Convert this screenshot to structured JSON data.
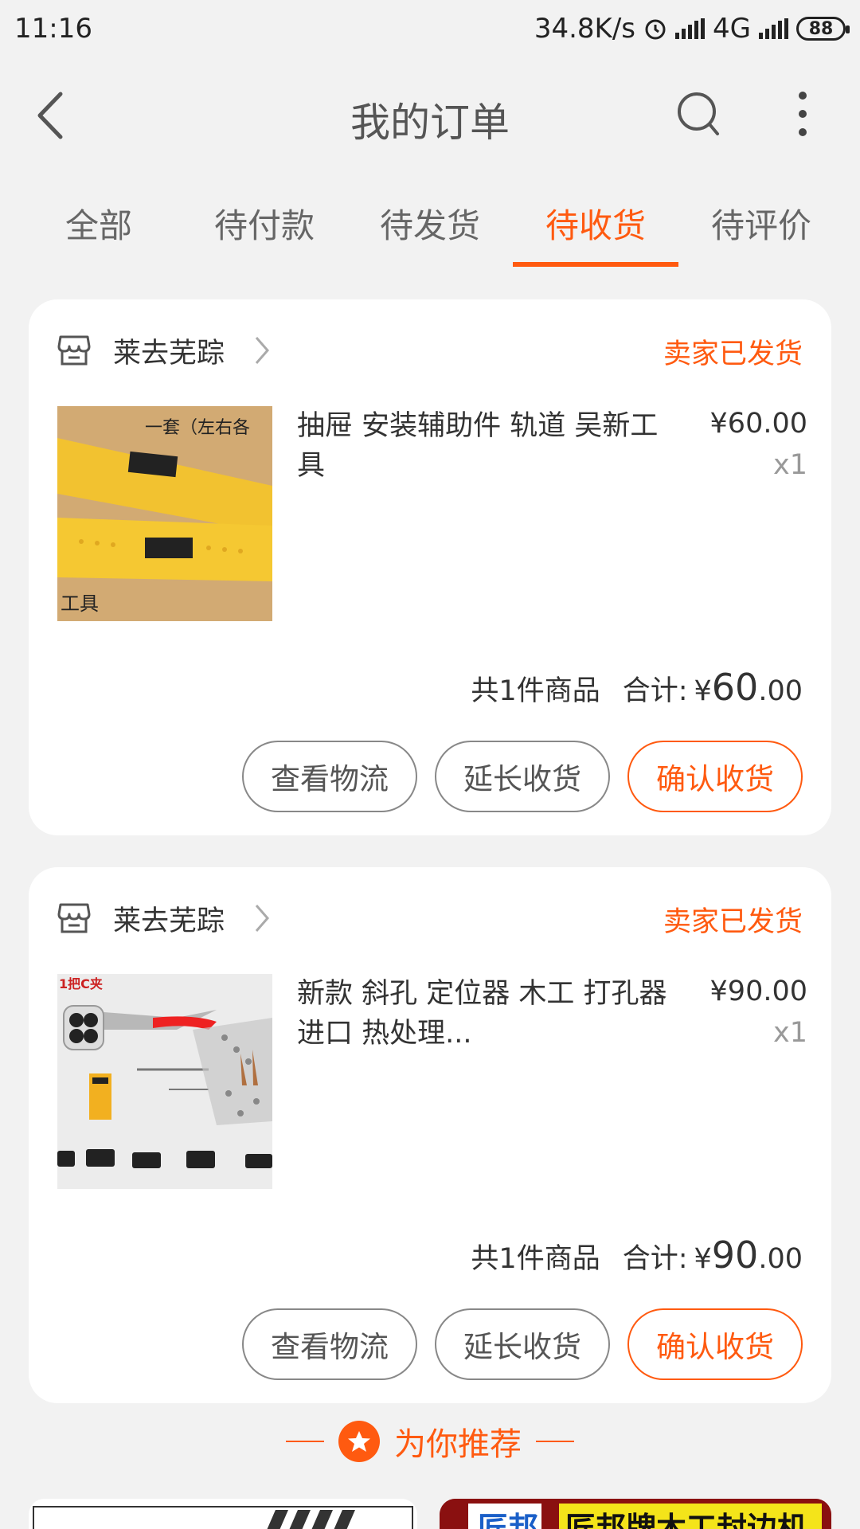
{
  "status_bar": {
    "time": "11:16",
    "net_speed": "34.8K/s",
    "network": "4G",
    "battery": "88"
  },
  "header": {
    "title": "我的订单"
  },
  "tabs": [
    {
      "label": "全部",
      "active": false
    },
    {
      "label": "待付款",
      "active": false
    },
    {
      "label": "待发货",
      "active": false
    },
    {
      "label": "待收货",
      "active": true
    },
    {
      "label": "待评价",
      "active": false
    }
  ],
  "orders": [
    {
      "shop_name": "莱去芜踪",
      "status": "卖家已发货",
      "product_name": "抽屉 安装辅助件 轨道 吴新工具",
      "price": "¥60.00",
      "qty": "x1",
      "item_count": "共1件商品",
      "total_label": "合计:",
      "total_currency": "¥",
      "total_int": "60",
      "total_dec": ".00",
      "thumb_caption_top": "一套（左右各",
      "thumb_caption_bottom": "工具",
      "actions": [
        "查看物流",
        "延长收货",
        "确认收货"
      ]
    },
    {
      "shop_name": "莱去芜踪",
      "status": "卖家已发货",
      "product_name": "新款 斜孔 定位器 木工 打孔器 进口  热处理...",
      "price": "¥90.00",
      "qty": "x1",
      "item_count": "共1件商品",
      "total_label": "合计:",
      "total_currency": "¥",
      "total_int": "90",
      "total_dec": ".00",
      "thumb_caption_top": "1把C夹",
      "actions": [
        "查看物流",
        "延长收货",
        "确认收货"
      ]
    }
  ],
  "recommend": {
    "title": "为你推荐",
    "right_card_text": "匠邦牌木工封边机",
    "right_card_logo": "匠邦"
  },
  "colors": {
    "accent": "#ff5a10",
    "background": "#f2f2f2"
  }
}
